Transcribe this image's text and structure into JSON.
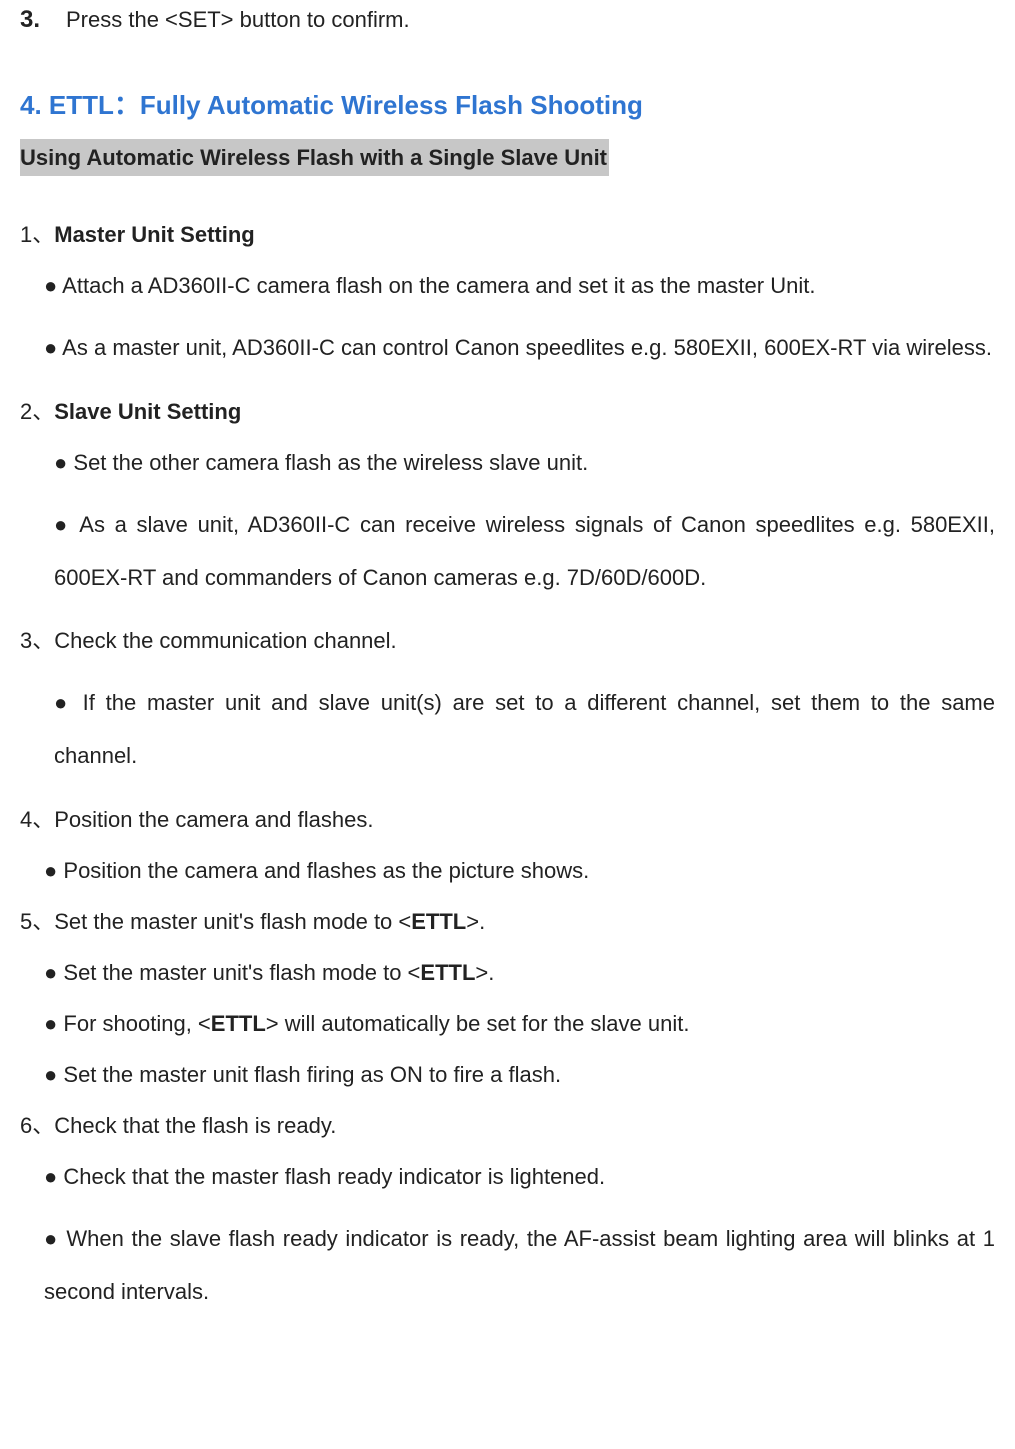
{
  "intro": {
    "num": "3.",
    "text": "Press the <SET> button to confirm."
  },
  "section4": {
    "title": "4. ETTL：Fully Automatic Wireless Flash Shooting",
    "subtitle": "Using Automatic Wireless Flash with a Single Slave Unit"
  },
  "items": {
    "i1": {
      "lead": "1、",
      "title": "Master Unit Setting",
      "b1": "● Attach a AD360II-C camera flash on the camera and set it as the master Unit.",
      "b2": "● As a master unit, AD360II-C can control Canon speedlites e.g. 580EXII, 600EX-RT via wireless."
    },
    "i2": {
      "lead": "2、",
      "title": "Slave Unit Setting",
      "b1": "● Set the other camera flash as the wireless slave unit.",
      "b2": "● As a slave unit, AD360II-C can receive wireless signals of Canon speedlites e.g. 580EXII, 600EX-RT and commanders of Canon cameras e.g. 7D/60D/600D."
    },
    "i3": {
      "lead": "3、",
      "title": "Check the communication channel.",
      "b1": "● If the master unit and slave unit(s) are set to a different channel, set them to the same channel."
    },
    "i4": {
      "lead": "4、",
      "title": "Position the camera and flashes.",
      "b1": "● Position the camera and flashes as the picture shows."
    },
    "i5": {
      "lead": "5、",
      "title_pre": "Set the master unit's flash mode to <",
      "title_bold": "ETTL",
      "title_post": ">.",
      "b1_pre": "● Set the master unit's flash mode to <",
      "b1_bold": "ETTL",
      "b1_post": ">.",
      "b2_pre": "● For shooting, <",
      "b2_bold": "ETTL",
      "b2_post": "> will automatically be set for the slave unit.",
      "b3": "● Set the master unit flash firing as ON to fire a flash."
    },
    "i6": {
      "lead": "6、",
      "title": "Check that the flash is ready.",
      "b1": "● Check that the master flash ready indicator is lightened.",
      "b2": "● When the slave flash ready indicator is ready, the AF-assist beam lighting area will blinks at 1 second intervals."
    }
  }
}
